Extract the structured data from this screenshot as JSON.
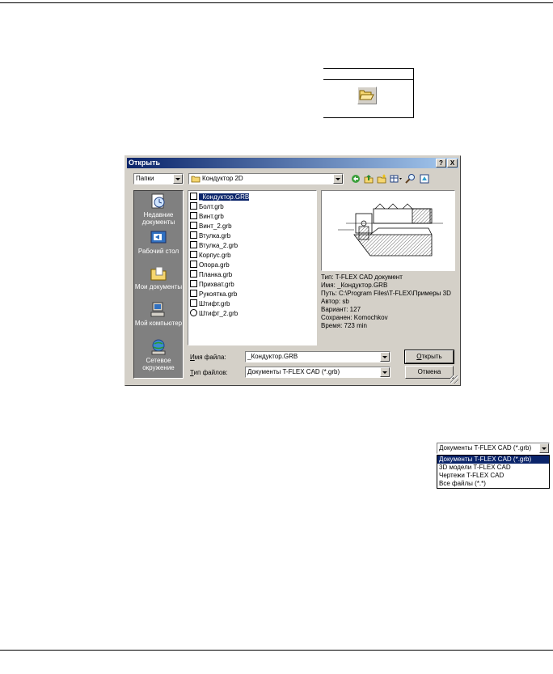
{
  "dialog": {
    "title": "Открыть",
    "help_btn": "?",
    "close_btn": "X",
    "lookin_label": "Папки",
    "folder": "Кондуктор 2D",
    "places": [
      {
        "label": "Недавние документы",
        "icon": "recent-docs-icon"
      },
      {
        "label": "Рабочий стол",
        "icon": "desktop-icon"
      },
      {
        "label": "Мои документы",
        "icon": "my-documents-icon"
      },
      {
        "label": "Мой компьютер",
        "icon": "my-computer-icon"
      },
      {
        "label": "Сетевое окружение",
        "icon": "network-icon"
      }
    ],
    "files": [
      "_Кондуктор.GRB",
      "Болт.grb",
      "Винт.grb",
      "Винт_2.grb",
      "Втулка.grb",
      "Втулка_2.grb",
      "Корпус.grb",
      "Опора.grb",
      "Планка.grb",
      "Прихват.grb",
      "Рукоятка.grb",
      "Штифт.grb",
      "Штифт_2.grb"
    ],
    "info": {
      "type": "Тип: T-FLEX CAD документ",
      "name": "Имя: _Кондуктор.GRB",
      "path": "Путь: C:\\Program Files\\T-FLEX\\Примеры 3D",
      "author": "Автор: sb",
      "variant": "Вариант: 127",
      "saved": "Сохранен: Komochkov",
      "time": "Время: 723 min"
    },
    "filename_label_u": "И",
    "filename_label_rest": "мя файла:",
    "filename_value": "_Кондуктор.GRB",
    "filetype_label_u": "Т",
    "filetype_label_rest": "ип файлов:",
    "filetype_value": "Документы T-FLEX CAD (*.grb)",
    "open_btn_u": "О",
    "open_btn_rest": "ткрыть",
    "cancel_btn": "Отмена"
  },
  "filetype_dropdown": {
    "selected": "Документы T-FLEX CAD (*.grb)",
    "options": [
      "Документы T-FLEX CAD (*.grb)",
      "3D модели T-FLEX CAD",
      "Чертежи T-FLEX CAD",
      "Все файлы (*.*)"
    ]
  },
  "colors": {
    "title_bar": "#0a246a",
    "face": "#d4d0c8",
    "places_bg": "#808080",
    "selection": "#0a246a"
  }
}
